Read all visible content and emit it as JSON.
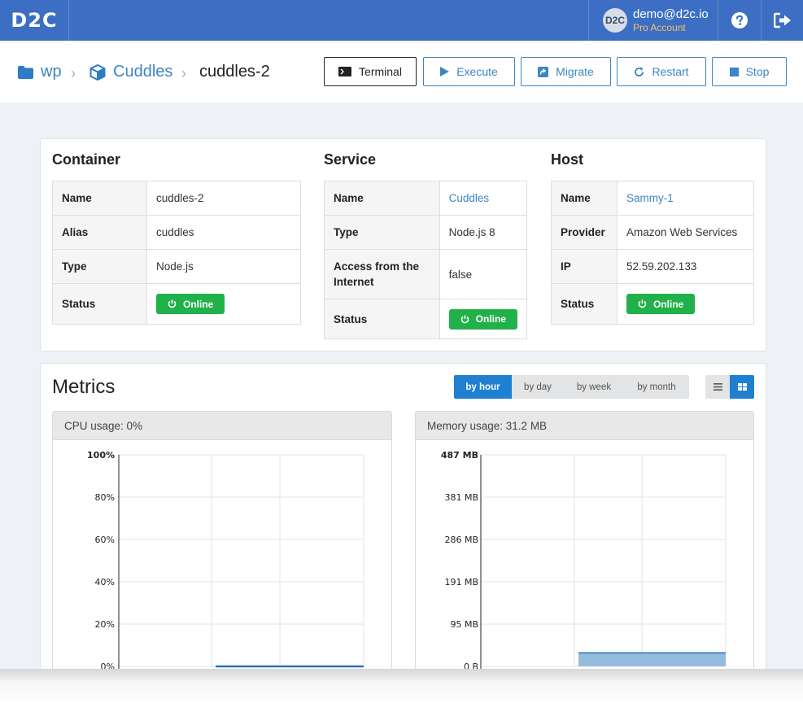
{
  "app": {
    "logo": "D2C"
  },
  "user": {
    "avatar_initials": "D2C",
    "email": "demo@d2c.io",
    "plan": "Pro Account"
  },
  "topbar_icons": {
    "help": "help-icon",
    "logout": "logout-icon"
  },
  "breadcrumb": {
    "project": "wp",
    "service": "Cuddles",
    "container": "cuddles-2"
  },
  "actions": {
    "terminal": "Terminal",
    "execute": "Execute",
    "migrate": "Migrate",
    "restart": "Restart",
    "stop": "Stop"
  },
  "container": {
    "title": "Container",
    "rows": [
      {
        "key": "Name",
        "value": "cuddles-2"
      },
      {
        "key": "Alias",
        "value": "cuddles"
      },
      {
        "key": "Type",
        "value": "Node.js"
      },
      {
        "key": "Status",
        "value": "Online"
      }
    ]
  },
  "service": {
    "title": "Service",
    "rows": [
      {
        "key": "Name",
        "value": "Cuddles"
      },
      {
        "key": "Type",
        "value": "Node.js 8"
      },
      {
        "key": "Access from the Internet",
        "value": "false"
      },
      {
        "key": "Status",
        "value": "Online"
      }
    ]
  },
  "host": {
    "title": "Host",
    "rows": [
      {
        "key": "Name",
        "value": "Sammy-1"
      },
      {
        "key": "Provider",
        "value": "Amazon Web Services"
      },
      {
        "key": "IP",
        "value": "52.59.202.133"
      },
      {
        "key": "Status",
        "value": "Online"
      }
    ]
  },
  "metrics": {
    "title": "Metrics",
    "periods": [
      "by hour",
      "by day",
      "by week",
      "by month"
    ],
    "active_period": "by hour",
    "active_view": "grid",
    "accent": "#1f7fd1"
  },
  "chart_data": [
    {
      "type": "line",
      "title": "CPU usage: 0%",
      "y_ticks": [
        "100%",
        "80%",
        "60%",
        "40%",
        "20%",
        "0%"
      ],
      "ylim": [
        0,
        100
      ],
      "series": [
        {
          "values": [
            0,
            0,
            0
          ],
          "color": "#2c6fb8"
        }
      ]
    },
    {
      "type": "area",
      "title": "Memory usage: 31.2 MB",
      "y_ticks": [
        "487 MB",
        "381 MB",
        "286 MB",
        "191 MB",
        "95 MB",
        "0 B"
      ],
      "ylim": [
        0,
        487
      ],
      "series": [
        {
          "values": [
            31.2,
            31.2,
            31.2
          ],
          "color": "#8fb8db"
        }
      ]
    }
  ],
  "status_color": "#21b14a"
}
